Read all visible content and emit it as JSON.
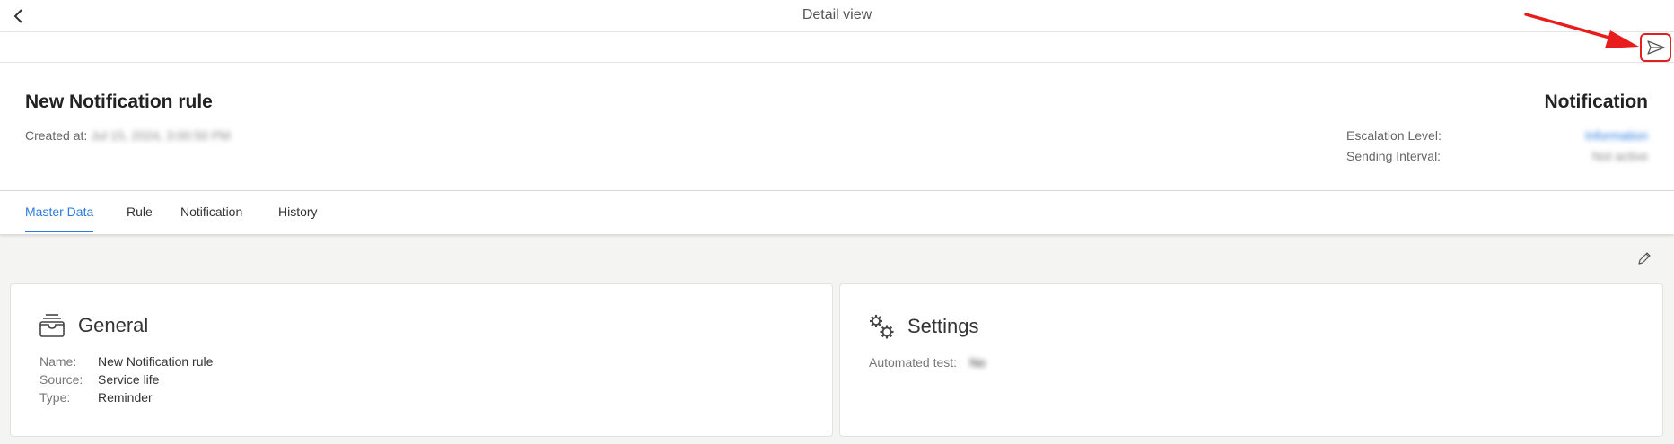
{
  "topbar": {
    "title": "Detail view"
  },
  "header": {
    "rule_name": "New Notification rule",
    "created_label": "Created at:",
    "created_value": "Jul 15, 2024, 3:00:50 PM",
    "type_title": "Notification",
    "escalation_label": "Escalation Level:",
    "escalation_value": "Information",
    "interval_label": "Sending Interval:",
    "interval_value": "Not active"
  },
  "tabs": [
    {
      "label": "Master Data",
      "active": true
    },
    {
      "label": "Rule",
      "active": false
    },
    {
      "label": "Notification",
      "active": false
    },
    {
      "label": "History",
      "active": false
    }
  ],
  "general": {
    "title": "General",
    "fields": [
      {
        "label": "Name:",
        "value": "New Notification rule"
      },
      {
        "label": "Source:",
        "value": "Service life"
      },
      {
        "label": "Type:",
        "value": "Reminder"
      }
    ]
  },
  "settings": {
    "title": "Settings",
    "automated_test_label": "Automated test:",
    "automated_test_value": "No"
  },
  "icons": {
    "back": "chevron-left-icon",
    "send": "send-icon",
    "edit": "pencil-icon",
    "general": "archive-box-icon",
    "settings": "gears-icon"
  },
  "colors": {
    "accent": "#2a7ae2",
    "highlight": "#e02020"
  }
}
